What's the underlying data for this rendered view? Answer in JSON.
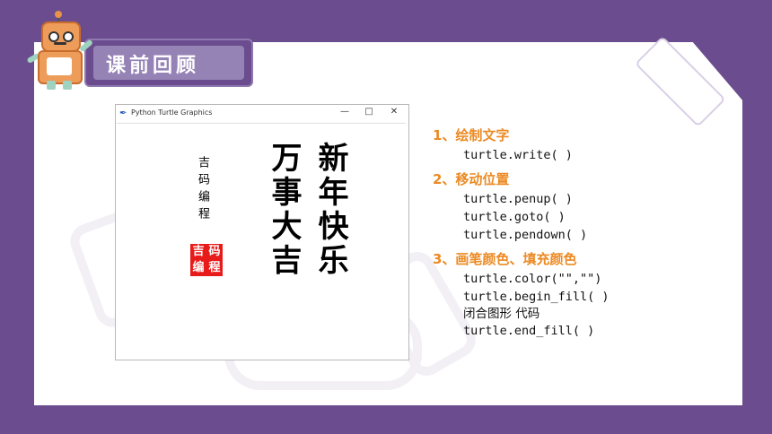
{
  "slide": {
    "title": "课前回顾"
  },
  "window": {
    "title": "Python Turtle Graphics",
    "controls": {
      "minimize": "—",
      "maximize": "□",
      "close": "✕"
    },
    "canvas": {
      "col_right": "新年快乐",
      "col_left": "万事大吉",
      "small_vertical": "吉码编程",
      "seal": [
        "吉",
        "码",
        "编",
        "程"
      ]
    }
  },
  "notes": [
    {
      "heading": "1、绘制文字",
      "lines": [
        "turtle.write( )"
      ]
    },
    {
      "heading": "2、移动位置",
      "lines": [
        "turtle.penup( )",
        "turtle.goto( )",
        "turtle.pendown( )"
      ]
    },
    {
      "heading": "3、画笔颜色、填充颜色",
      "lines": [
        "turtle.color(\"\",\"\")",
        "turtle.begin_fill( )",
        "闭合图形 代码",
        "turtle.end_fill( )"
      ]
    }
  ],
  "colors": {
    "background": "#6b4d8f",
    "heading": "#ec8a23",
    "seal": "#e81b1b"
  }
}
